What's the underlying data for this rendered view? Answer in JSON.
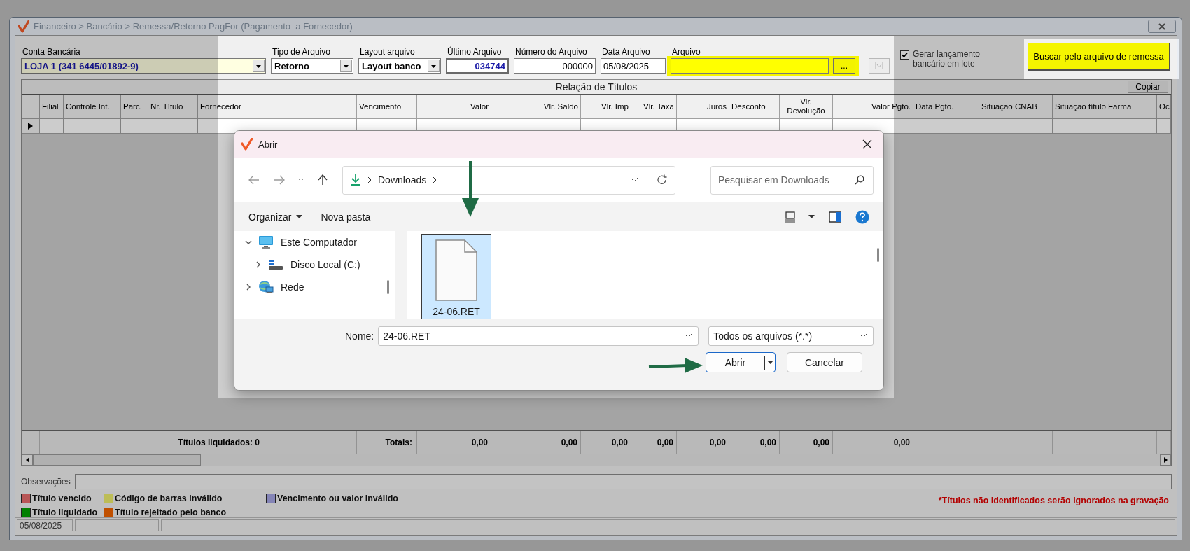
{
  "window": {
    "title": "Financeiro > Bancário > Remessa/Retorno PagFor (Pagamento  a Fornecedor)"
  },
  "form": {
    "fields": [
      {
        "label": "Conta Bancária",
        "kind": "dropdown",
        "value": "LOJA 1 (341 6445/01892-9)"
      },
      {
        "label": "Tipo de Arquivo",
        "kind": "dropdown",
        "value": "Retorno"
      },
      {
        "label": "Layout arquivo",
        "kind": "dropdown",
        "value": "Layout banco"
      },
      {
        "label": "Último Arquivo",
        "kind": "readonly",
        "value": "034744"
      },
      {
        "label": "Número do Arquivo",
        "kind": "text",
        "value": "000000"
      },
      {
        "label": "Data Arquivo",
        "kind": "text",
        "value": "05/08/2025"
      },
      {
        "label": "Arquivo",
        "kind": "file",
        "browse": "..."
      }
    ],
    "batch": {
      "label": "Gerar lançamento bancário em lote",
      "checked": true
    },
    "search_button": "Buscar pelo arquivo de remessa"
  },
  "table": {
    "title": "Relação de Títulos",
    "copy_button": "Copiar",
    "columns": [
      "Filial",
      "Controle Int.",
      "Parc.",
      "Nr. Título",
      "Fornecedor",
      "Vencimento",
      "Valor",
      "Vlr. Saldo",
      "Vlr. Imp",
      "Vlr. Taxa",
      "Juros",
      "Desconto",
      "Vlr. Devolução",
      "Valor Pgto.",
      "Data Pgto.",
      "Situação CNAB",
      "Situação título Farma",
      "Oc"
    ],
    "totals": {
      "settled": "Títulos liquidados: 0",
      "label": "Totais:",
      "values": [
        "0,00",
        "0,00",
        "0,00",
        "0,00",
        "0,00",
        "0,00",
        "0,00",
        "0,00"
      ]
    }
  },
  "observations": {
    "label": "Observações"
  },
  "legend": [
    {
      "label": "Título vencido",
      "color": "#b85656"
    },
    {
      "label": "Código de barras inválido",
      "color": "#bdbd56"
    },
    {
      "label": "Vencimento ou valor inválido",
      "color": "#8484b6"
    },
    {
      "label": "Título liquidado",
      "color": "#008000"
    },
    {
      "label": "Título rejeitado pelo banco",
      "color": "#c05000"
    }
  ],
  "note": "*Títulos não identificados serão ignorados na gravação",
  "status_bar": [
    "05/08/2025"
  ],
  "dialog": {
    "title": "Abrir",
    "path": [
      "Downloads"
    ],
    "search_placeholder": "Pesquisar em Downloads",
    "toolbar": [
      "Organizar",
      "Nova pasta"
    ],
    "tree": [
      {
        "label": "Este Computador",
        "kind": "computer",
        "expanded": true,
        "children": [
          {
            "label": "Disco Local (C:)",
            "kind": "drive",
            "expanded": false
          }
        ]
      },
      {
        "label": "Rede",
        "kind": "network",
        "expanded": false
      }
    ],
    "files": [
      {
        "name": "24-06.RET",
        "selected": true
      }
    ],
    "filename_label": "Nome:",
    "filename": "24-06.RET",
    "filter": "Todos os arquivos (*.*)",
    "open_button": "Abrir",
    "cancel_button": "Cancelar"
  }
}
